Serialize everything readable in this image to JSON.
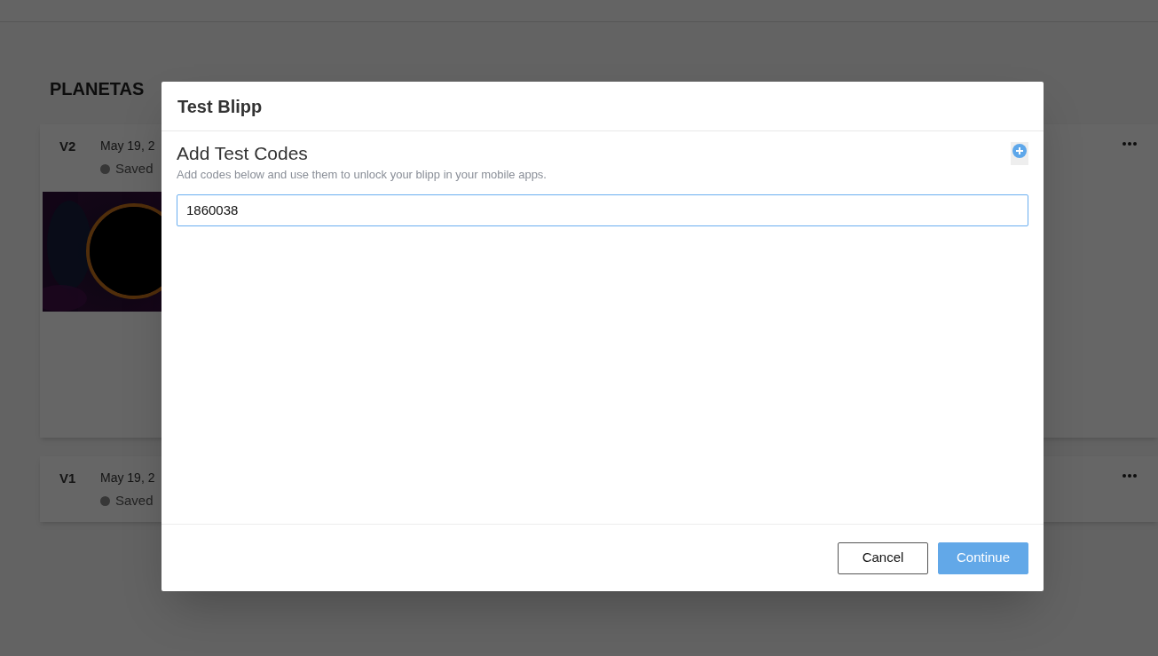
{
  "page": {
    "title": "PLANETAS"
  },
  "versions": [
    {
      "label": "V2",
      "date": "May 19, 2",
      "status": "Saved",
      "has_thumbnail": true
    },
    {
      "label": "V1",
      "date": "May 19, 2",
      "status": "Saved",
      "has_thumbnail": false
    }
  ],
  "dialog": {
    "title": "Test Blipp",
    "heading": "Add Test Codes",
    "description": "Add codes below and use them to unlock your blipp in your mobile apps.",
    "codes": [
      {
        "value": "1860038"
      }
    ],
    "buttons": [
      {
        "kind": "secondary",
        "label": "Cancel"
      },
      {
        "kind": "primary",
        "label": "Continue"
      }
    ]
  }
}
